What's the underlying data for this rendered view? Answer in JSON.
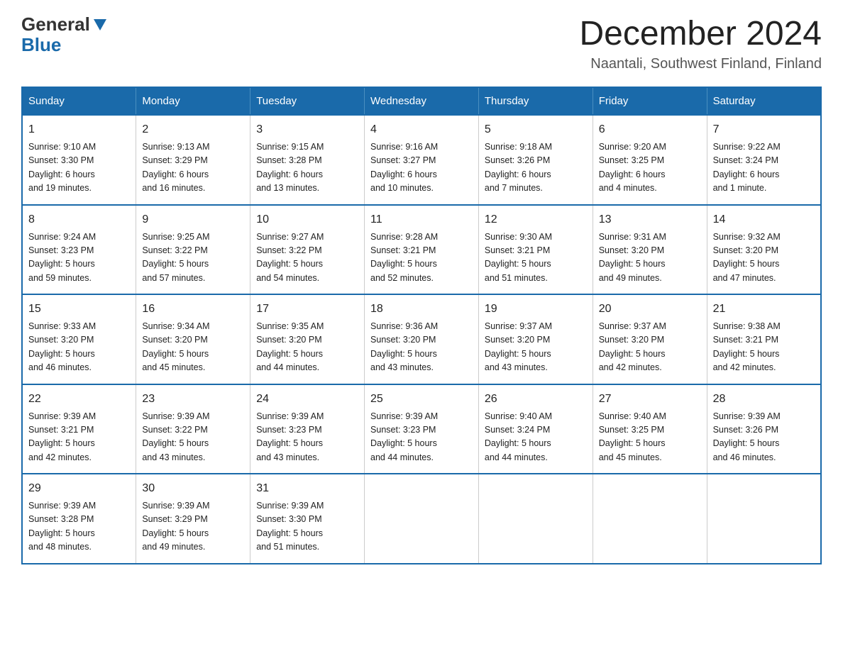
{
  "logo": {
    "line1": "General",
    "line2": "Blue"
  },
  "title": "December 2024",
  "location": "Naantali, Southwest Finland, Finland",
  "weekdays": [
    "Sunday",
    "Monday",
    "Tuesday",
    "Wednesday",
    "Thursday",
    "Friday",
    "Saturday"
  ],
  "weeks": [
    [
      {
        "day": "1",
        "sunrise": "9:10 AM",
        "sunset": "3:30 PM",
        "daylight": "6 hours and 19 minutes."
      },
      {
        "day": "2",
        "sunrise": "9:13 AM",
        "sunset": "3:29 PM",
        "daylight": "6 hours and 16 minutes."
      },
      {
        "day": "3",
        "sunrise": "9:15 AM",
        "sunset": "3:28 PM",
        "daylight": "6 hours and 13 minutes."
      },
      {
        "day": "4",
        "sunrise": "9:16 AM",
        "sunset": "3:27 PM",
        "daylight": "6 hours and 10 minutes."
      },
      {
        "day": "5",
        "sunrise": "9:18 AM",
        "sunset": "3:26 PM",
        "daylight": "6 hours and 7 minutes."
      },
      {
        "day": "6",
        "sunrise": "9:20 AM",
        "sunset": "3:25 PM",
        "daylight": "6 hours and 4 minutes."
      },
      {
        "day": "7",
        "sunrise": "9:22 AM",
        "sunset": "3:24 PM",
        "daylight": "6 hours and 1 minute."
      }
    ],
    [
      {
        "day": "8",
        "sunrise": "9:24 AM",
        "sunset": "3:23 PM",
        "daylight": "5 hours and 59 minutes."
      },
      {
        "day": "9",
        "sunrise": "9:25 AM",
        "sunset": "3:22 PM",
        "daylight": "5 hours and 57 minutes."
      },
      {
        "day": "10",
        "sunrise": "9:27 AM",
        "sunset": "3:22 PM",
        "daylight": "5 hours and 54 minutes."
      },
      {
        "day": "11",
        "sunrise": "9:28 AM",
        "sunset": "3:21 PM",
        "daylight": "5 hours and 52 minutes."
      },
      {
        "day": "12",
        "sunrise": "9:30 AM",
        "sunset": "3:21 PM",
        "daylight": "5 hours and 51 minutes."
      },
      {
        "day": "13",
        "sunrise": "9:31 AM",
        "sunset": "3:20 PM",
        "daylight": "5 hours and 49 minutes."
      },
      {
        "day": "14",
        "sunrise": "9:32 AM",
        "sunset": "3:20 PM",
        "daylight": "5 hours and 47 minutes."
      }
    ],
    [
      {
        "day": "15",
        "sunrise": "9:33 AM",
        "sunset": "3:20 PM",
        "daylight": "5 hours and 46 minutes."
      },
      {
        "day": "16",
        "sunrise": "9:34 AM",
        "sunset": "3:20 PM",
        "daylight": "5 hours and 45 minutes."
      },
      {
        "day": "17",
        "sunrise": "9:35 AM",
        "sunset": "3:20 PM",
        "daylight": "5 hours and 44 minutes."
      },
      {
        "day": "18",
        "sunrise": "9:36 AM",
        "sunset": "3:20 PM",
        "daylight": "5 hours and 43 minutes."
      },
      {
        "day": "19",
        "sunrise": "9:37 AM",
        "sunset": "3:20 PM",
        "daylight": "5 hours and 43 minutes."
      },
      {
        "day": "20",
        "sunrise": "9:37 AM",
        "sunset": "3:20 PM",
        "daylight": "5 hours and 42 minutes."
      },
      {
        "day": "21",
        "sunrise": "9:38 AM",
        "sunset": "3:21 PM",
        "daylight": "5 hours and 42 minutes."
      }
    ],
    [
      {
        "day": "22",
        "sunrise": "9:39 AM",
        "sunset": "3:21 PM",
        "daylight": "5 hours and 42 minutes."
      },
      {
        "day": "23",
        "sunrise": "9:39 AM",
        "sunset": "3:22 PM",
        "daylight": "5 hours and 43 minutes."
      },
      {
        "day": "24",
        "sunrise": "9:39 AM",
        "sunset": "3:23 PM",
        "daylight": "5 hours and 43 minutes."
      },
      {
        "day": "25",
        "sunrise": "9:39 AM",
        "sunset": "3:23 PM",
        "daylight": "5 hours and 44 minutes."
      },
      {
        "day": "26",
        "sunrise": "9:40 AM",
        "sunset": "3:24 PM",
        "daylight": "5 hours and 44 minutes."
      },
      {
        "day": "27",
        "sunrise": "9:40 AM",
        "sunset": "3:25 PM",
        "daylight": "5 hours and 45 minutes."
      },
      {
        "day": "28",
        "sunrise": "9:39 AM",
        "sunset": "3:26 PM",
        "daylight": "5 hours and 46 minutes."
      }
    ],
    [
      {
        "day": "29",
        "sunrise": "9:39 AM",
        "sunset": "3:28 PM",
        "daylight": "5 hours and 48 minutes."
      },
      {
        "day": "30",
        "sunrise": "9:39 AM",
        "sunset": "3:29 PM",
        "daylight": "5 hours and 49 minutes."
      },
      {
        "day": "31",
        "sunrise": "9:39 AM",
        "sunset": "3:30 PM",
        "daylight": "5 hours and 51 minutes."
      },
      null,
      null,
      null,
      null
    ]
  ],
  "labels": {
    "sunrise": "Sunrise:",
    "sunset": "Sunset:",
    "daylight": "Daylight:"
  }
}
